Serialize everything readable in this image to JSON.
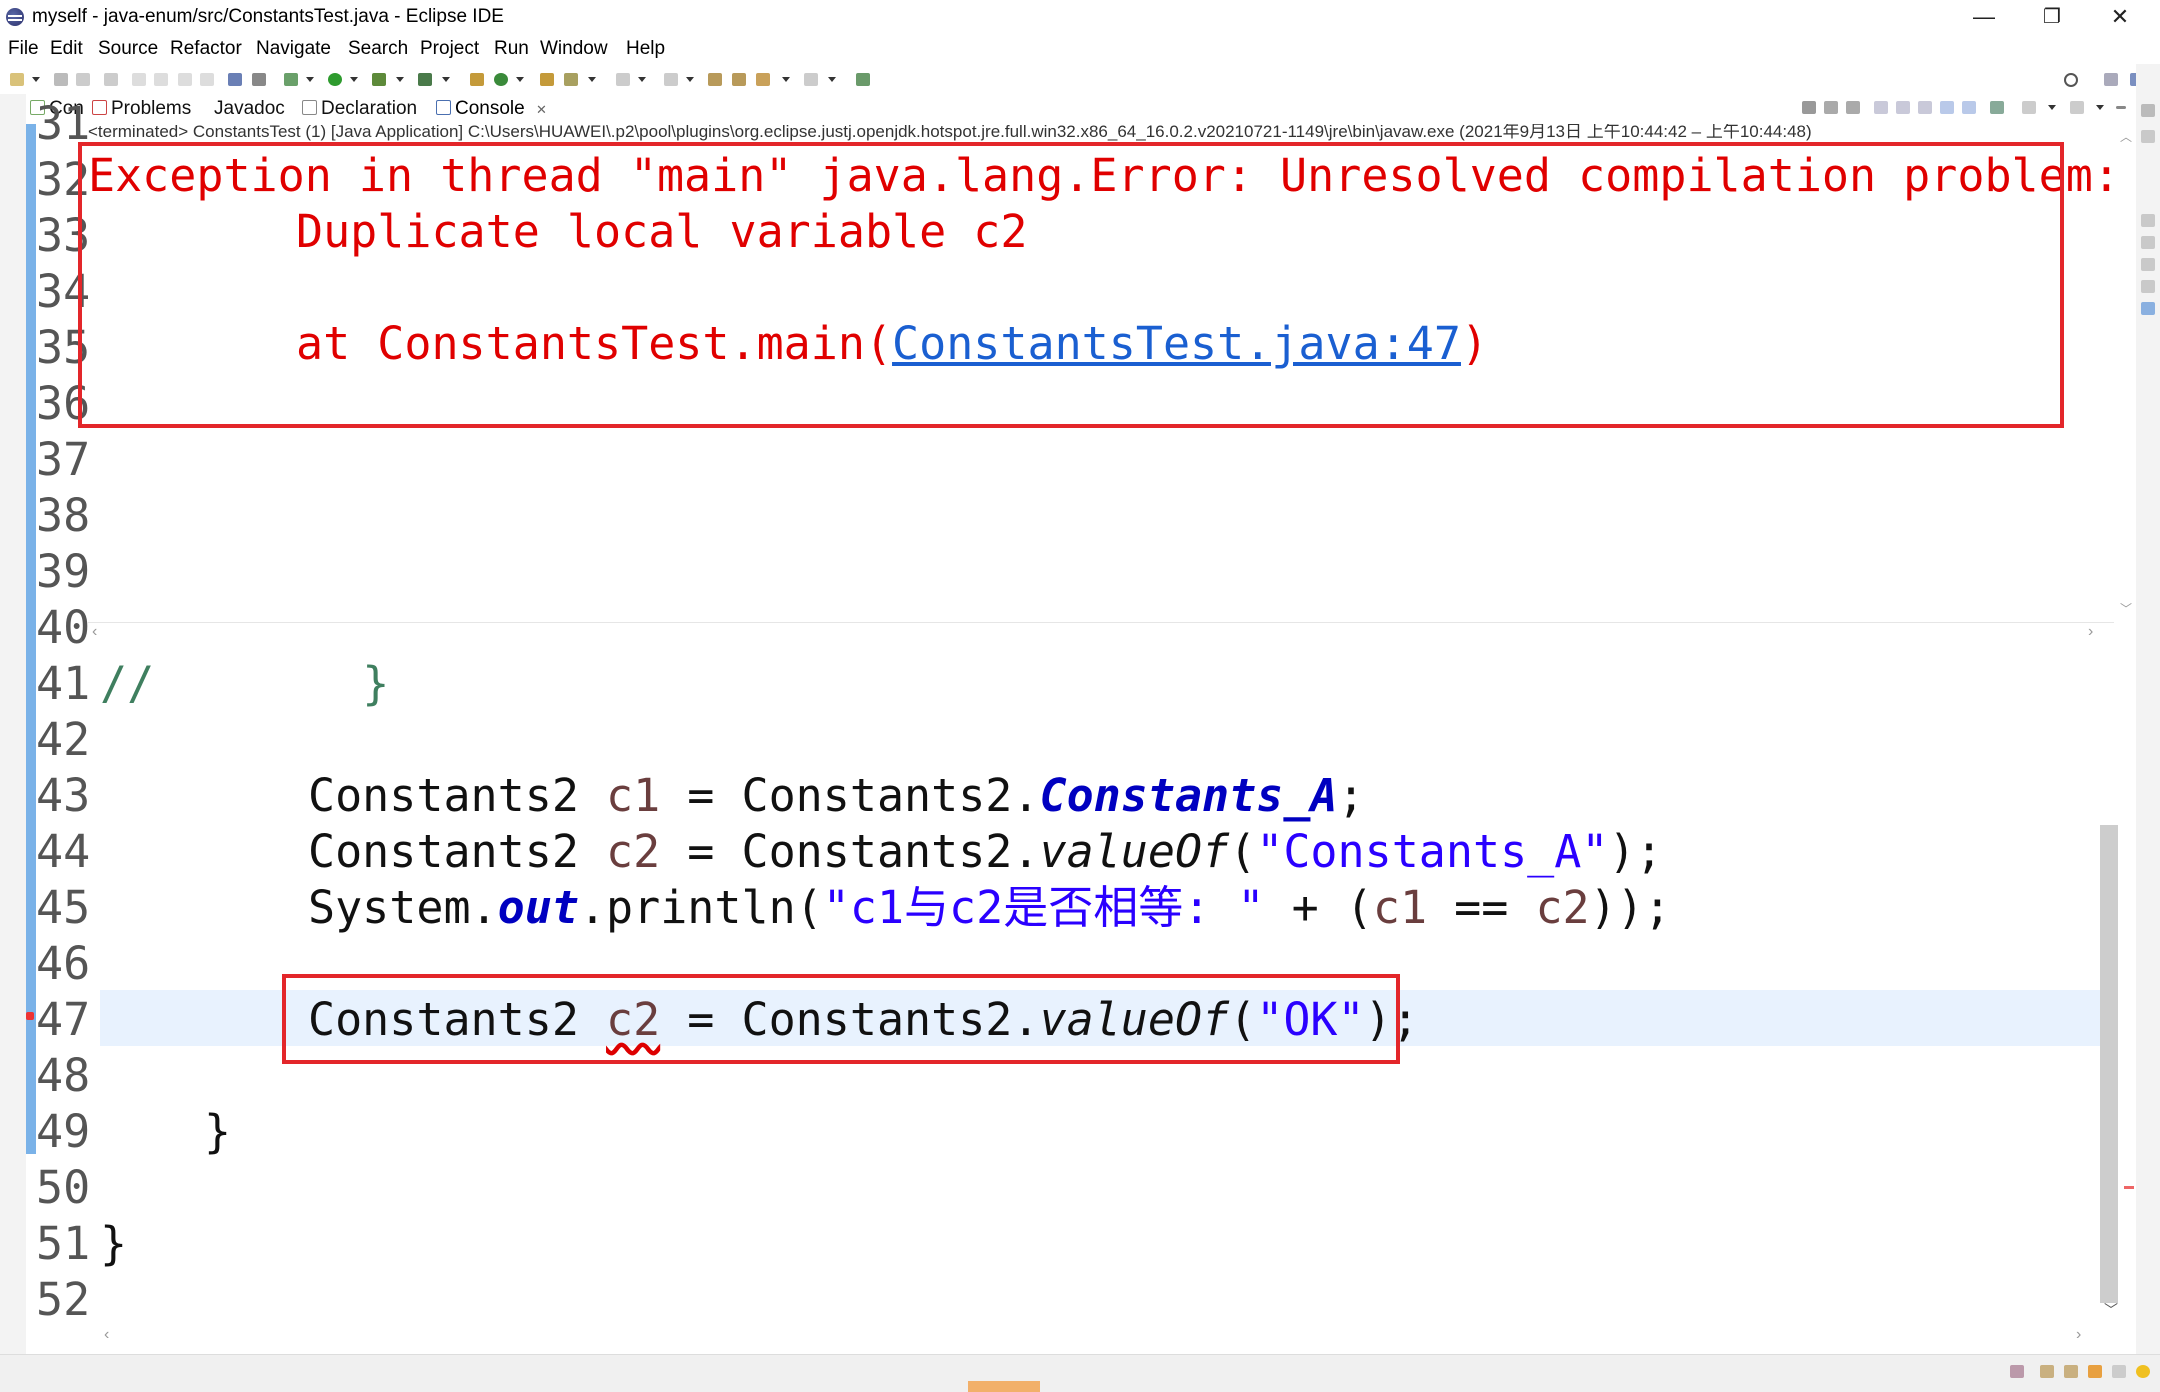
{
  "window": {
    "title": "myself - java-enum/src/ConstantsTest.java - Eclipse IDE",
    "minimize": "—",
    "restore": "❐",
    "close": "✕"
  },
  "menu": [
    "File",
    "Edit",
    "Source",
    "Refactor",
    "Navigate",
    "Search",
    "Project",
    "Run",
    "Window",
    "Help"
  ],
  "tabs": [
    {
      "label": "Con",
      "icon": "console-view-icon"
    },
    {
      "label": "Problems",
      "icon": "problems-icon"
    },
    {
      "label": "Javadoc",
      "icon": "javadoc-icon"
    },
    {
      "label": "Declaration",
      "icon": "declaration-icon"
    },
    {
      "label": "Console",
      "icon": "console-icon",
      "close": "✕"
    }
  ],
  "console": {
    "terminated": "<terminated> ConstantsTest (1) [Java Application] C:\\Users\\HUAWEI\\.p2\\pool\\plugins\\org.eclipse.justj.openjdk.hotspot.jre.full.win32.x86_64_16.0.2.v20210721-1149\\jre\\bin\\javaw.exe  (2021年9月13日 上午10:44:42 – 上午10:44:48)",
    "line1": "Exception in thread \"main\" java.lang.Error: Unresolved compilation problem: ",
    "line2": "\tDuplicate local variable c2",
    "line3_prefix": "\tat ConstantsTest.main(",
    "line3_link": "ConstantsTest.java:47",
    "line3_suffix": ")"
  },
  "line_numbers": [
    "31",
    "32",
    "33",
    "34",
    "35",
    "36",
    "37",
    "38",
    "39",
    "40",
    "41",
    "42",
    "43",
    "44",
    "45",
    "46",
    "47",
    "48",
    "49",
    "50",
    "51",
    "52"
  ],
  "code": {
    "l41_comment": "//",
    "l41_brace": "}",
    "l43_type": "Constants2 ",
    "l43_var": "c1",
    "l43_eq": " = Constants2.",
    "l43_field": "Constants_A",
    "l43_end": ";",
    "l44_type": "Constants2 ",
    "l44_var": "c2",
    "l44_eq": " = Constants2.",
    "l44_method": "valueOf",
    "l44_open": "(",
    "l44_str": "\"Constants_A\"",
    "l44_end": ");",
    "l45_sys": "System.",
    "l45_out": "out",
    "l45_print": ".println(",
    "l45_str": "\"c1与c2是否相等: \"",
    "l45_plus": " + (",
    "l45_c1": "c1",
    "l45_eqeq": " == ",
    "l45_c2": "c2",
    "l45_end": "));",
    "l47_type": "Constants2 ",
    "l47_var": "c2",
    "l47_eq": " = Constants2.",
    "l47_method": "valueOf",
    "l47_open": "(",
    "l47_str": "\"OK\"",
    "l47_end": ");",
    "l49_brace": "}",
    "l51_brace": "}"
  },
  "colors": {
    "error_red": "#e00000",
    "highlight_box": "#e3262a",
    "link_blue": "#1a5fd1",
    "field_blue": "#0000c0",
    "string_blue": "#2a00ff",
    "comment_green": "#3f7f5f"
  }
}
